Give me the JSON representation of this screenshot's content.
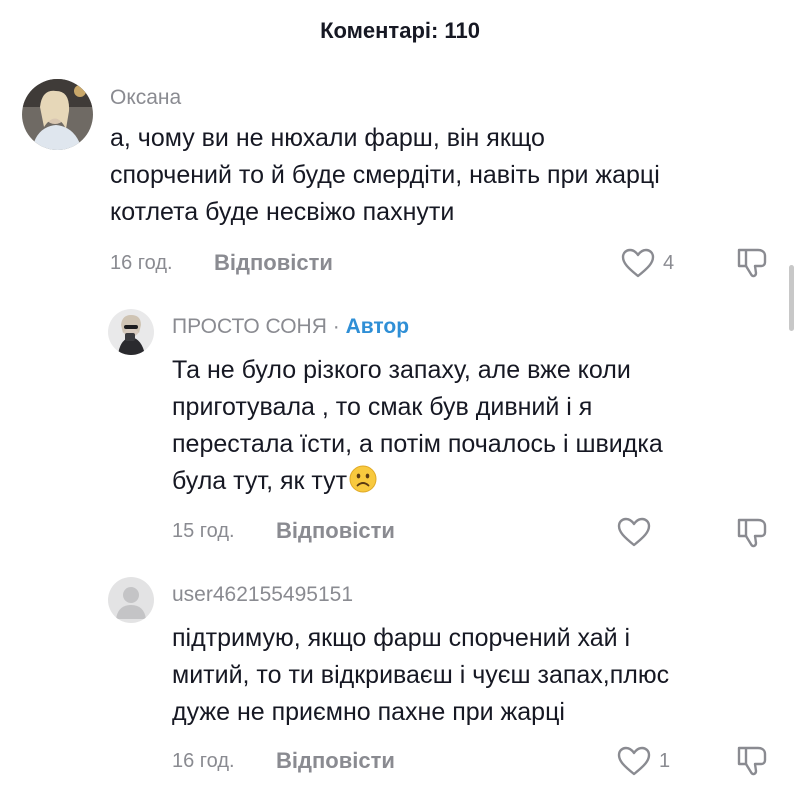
{
  "header": {
    "title": "Коментарі: 110"
  },
  "comments": [
    {
      "username": "Оксана",
      "lines": [
        "а, чому ви не нюхали фарш, він якщо",
        "спорчений то й буде смердіти, навіть при жарці",
        "котлета буде несвіжо пахнути"
      ],
      "time": "16 год.",
      "reply_label": "Відповісти",
      "likes": "4"
    },
    {
      "username": "ПРОСТО СОНЯ",
      "separator": "·",
      "author_badge": "Автор",
      "lines": [
        "Та не було різкого запаху, але вже коли",
        "приготувала , то смак був дивний і я",
        "перестала їсти, а потім почалось і швидка",
        "була тут, як тут"
      ],
      "emoji": "frowning-face",
      "time": "15 год.",
      "reply_label": "Відповісти",
      "likes": ""
    },
    {
      "username": "user462155495151",
      "lines": [
        "підтримую, якщо фарш спорчений хай і",
        "митий, то ти відкриваєш і чуєш запах,плюс",
        "дуже не приємно пахне при жарці"
      ],
      "time": "16 год.",
      "reply_label": "Відповісти",
      "likes": "1"
    }
  ],
  "icons": {
    "like": "heart-outline-icon",
    "dislike": "thumbs-down-icon"
  },
  "colors": {
    "author": "#2f8fd6",
    "muted": "#8a8b91",
    "text": "#161823"
  }
}
